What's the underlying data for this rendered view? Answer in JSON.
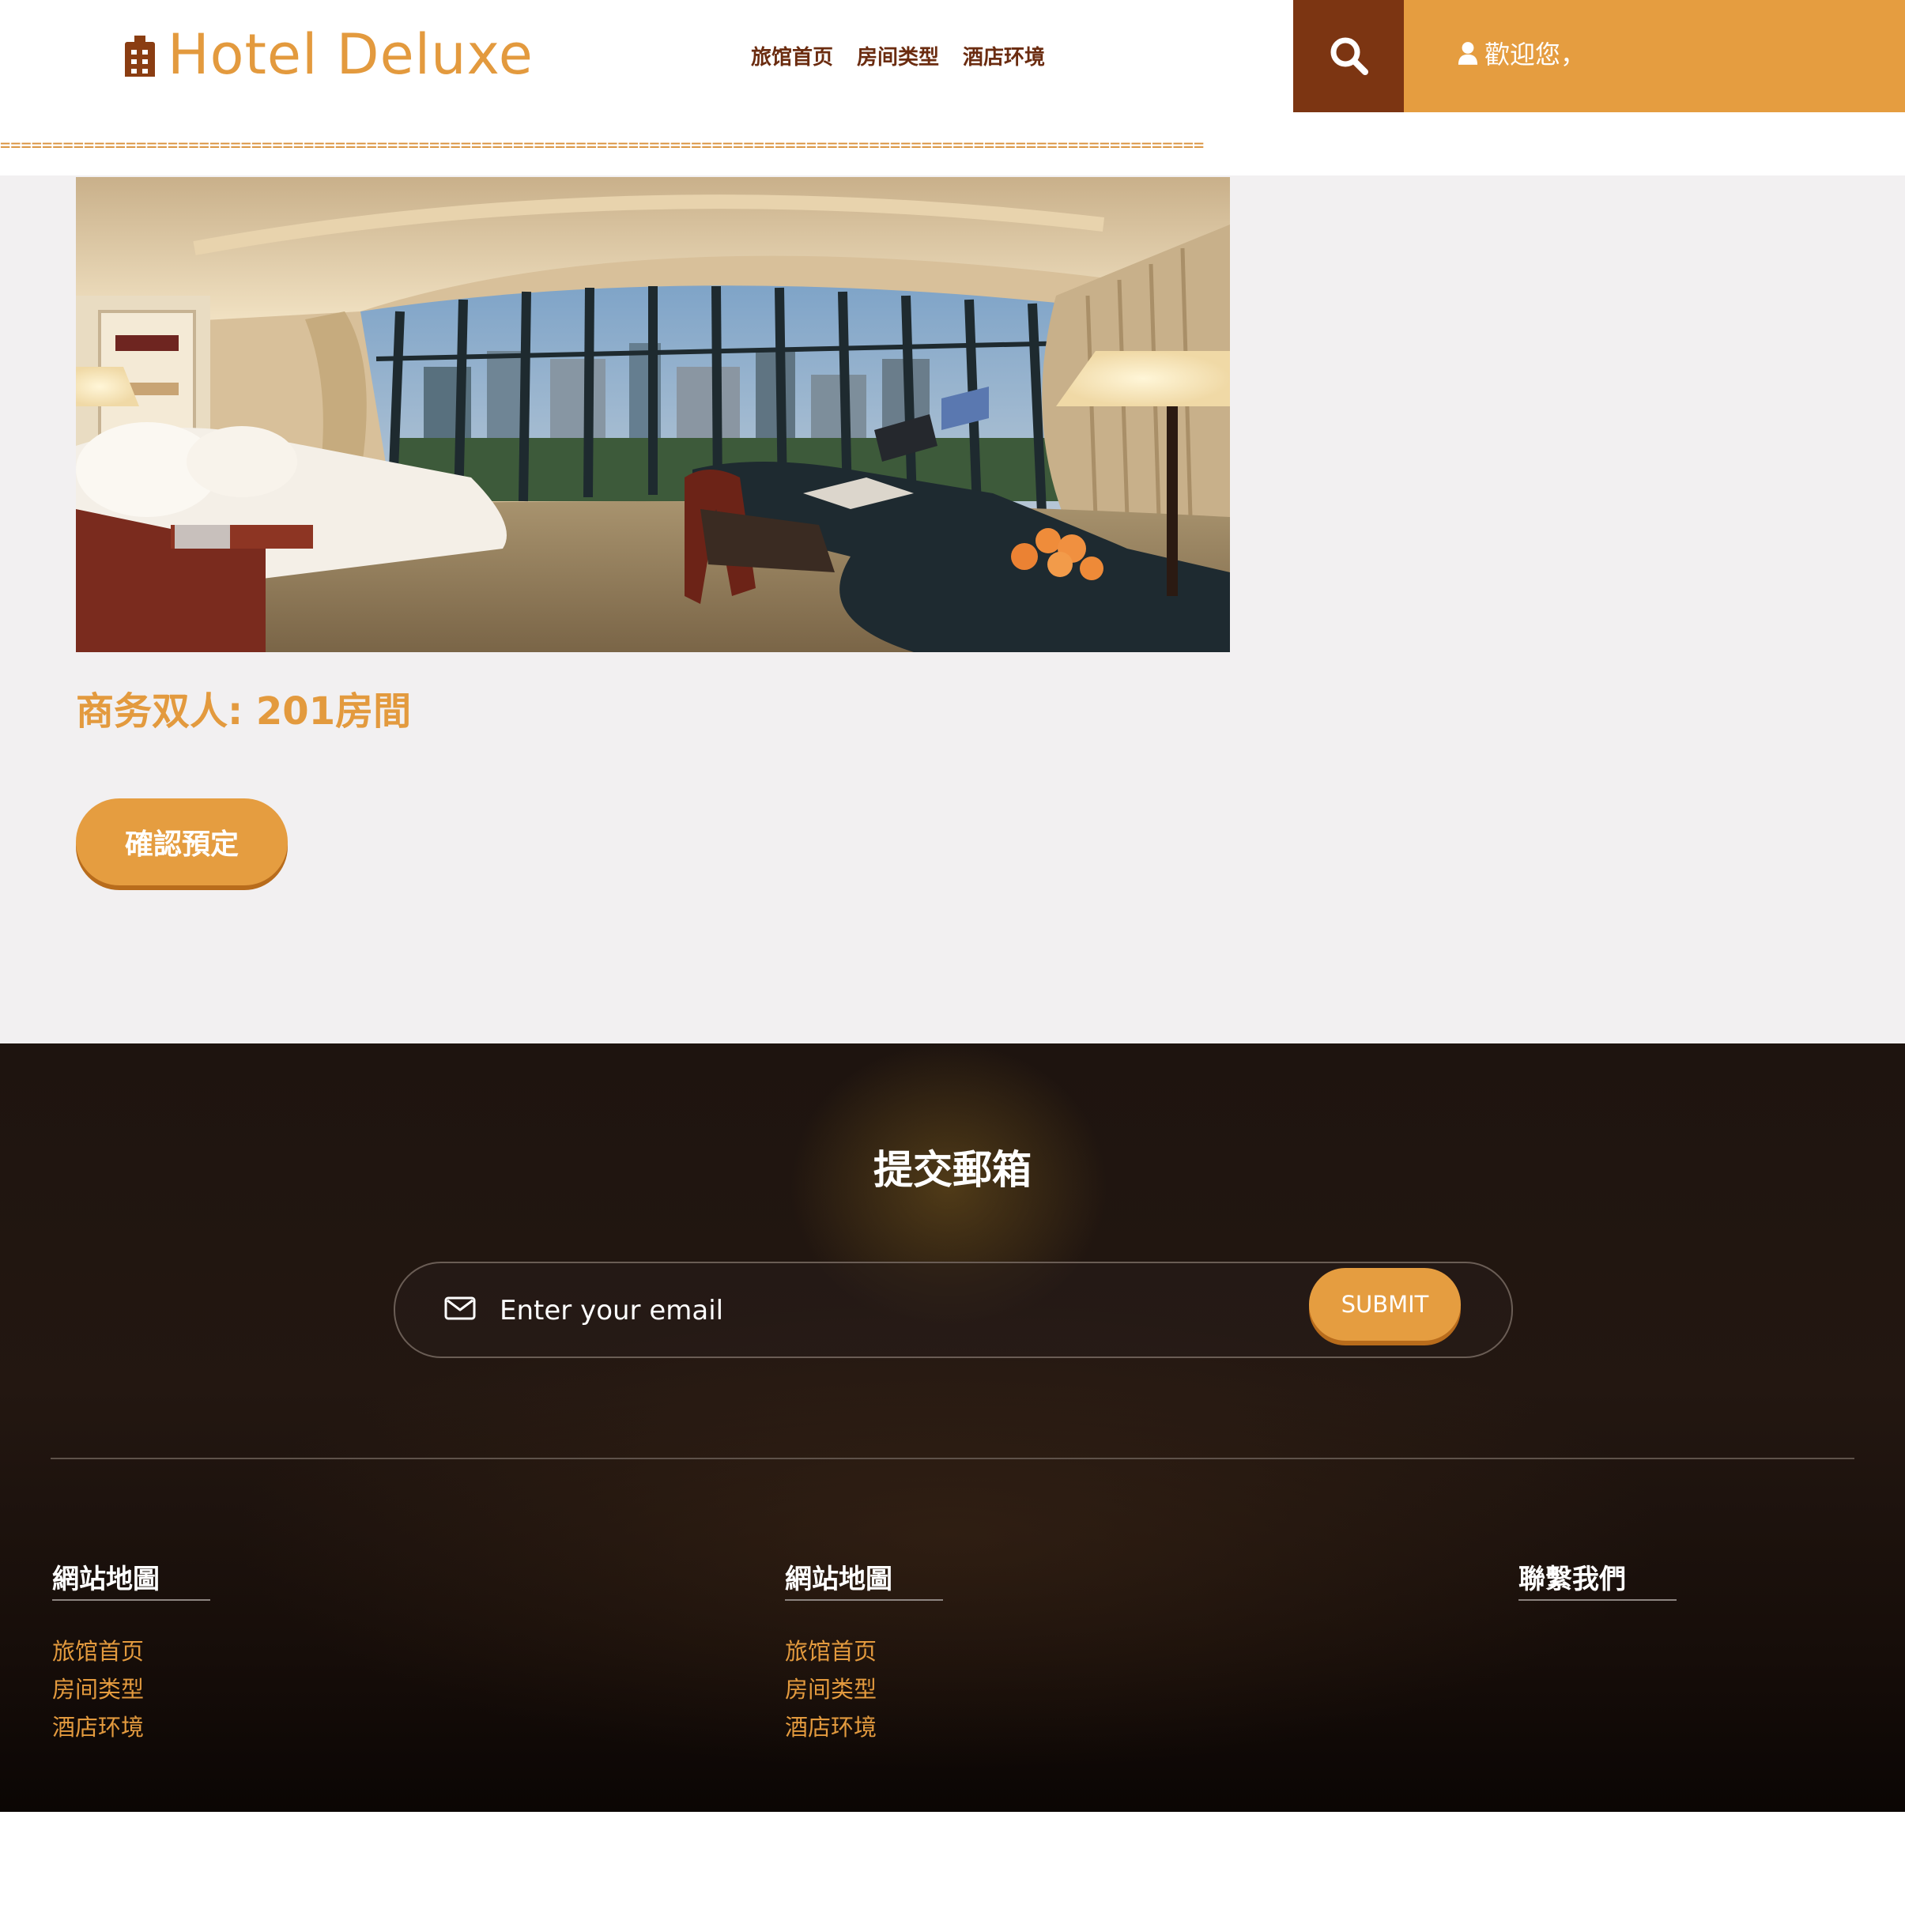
{
  "header": {
    "logo_text": "Hotel Deluxe",
    "nav": [
      "旅馆首页",
      "房间类型",
      "酒店环境"
    ],
    "welcome": "歡迎您，",
    "divider_text": "==================================================================================================================="
  },
  "main": {
    "room_title": "商务双人: 201房間",
    "book_button": "確認預定"
  },
  "footer": {
    "title": "提交郵箱",
    "email_placeholder": "Enter your email",
    "submit_label": "SUBMIT",
    "columns": [
      {
        "heading": "網站地圖",
        "links": [
          "旅馆首页",
          "房间类型",
          "酒店环境"
        ]
      },
      {
        "heading": "網站地圖",
        "links": [
          "旅馆首页",
          "房间类型",
          "酒店环境"
        ]
      },
      {
        "heading": "聯繫我們",
        "links": []
      }
    ]
  },
  "colors": {
    "accent": "#e59d40",
    "brown": "#7c3512",
    "background": "#f2f0f1",
    "footer_dark": "#1e140f"
  },
  "icons": [
    "building-icon",
    "search-icon",
    "user-icon",
    "mail-icon"
  ]
}
